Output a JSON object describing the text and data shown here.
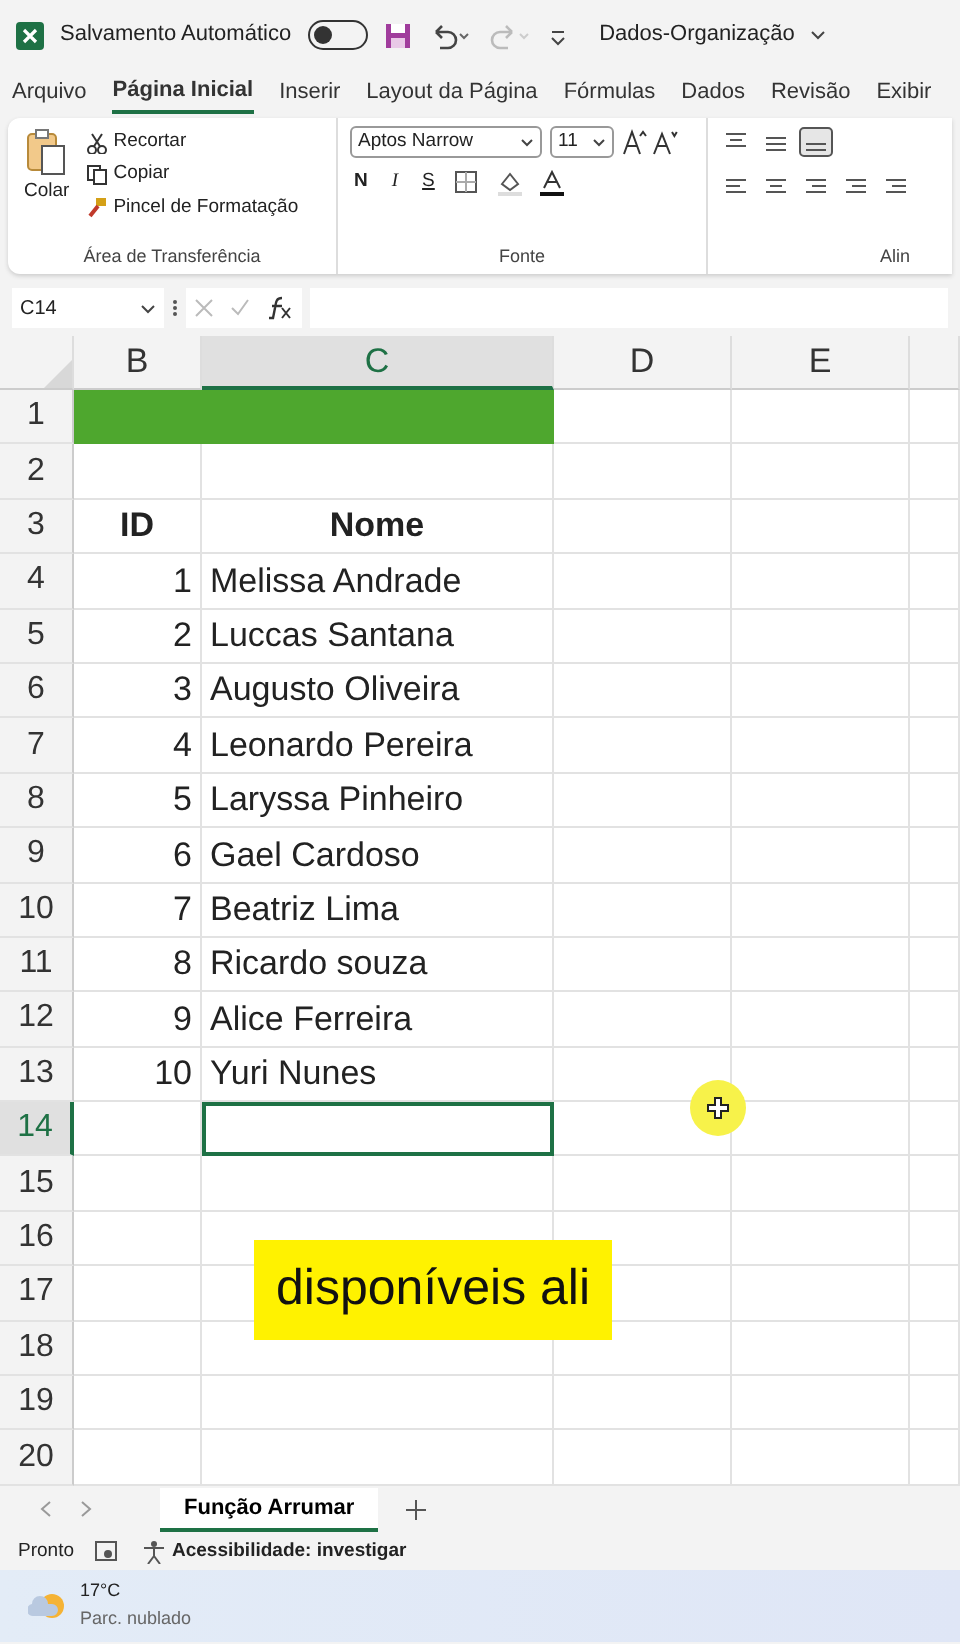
{
  "title_bar": {
    "autosave_label": "Salvamento Automático",
    "autosave_on": false,
    "file_name": "Dados-Organização"
  },
  "tabs": [
    {
      "label": "Arquivo",
      "selected": false
    },
    {
      "label": "Página Inicial",
      "selected": true
    },
    {
      "label": "Inserir",
      "selected": false
    },
    {
      "label": "Layout da Página",
      "selected": false
    },
    {
      "label": "Fórmulas",
      "selected": false
    },
    {
      "label": "Dados",
      "selected": false
    },
    {
      "label": "Revisão",
      "selected": false
    },
    {
      "label": "Exibir",
      "selected": false
    }
  ],
  "ribbon": {
    "clipboard": {
      "paste": "Colar",
      "cut": "Recortar",
      "copy": "Copiar",
      "format_painter": "Pincel de Formatação",
      "group": "Área de Transferência"
    },
    "font": {
      "font_name": "Aptos Narrow",
      "font_size": "11",
      "bold": "N",
      "italic": "I",
      "underline": "S",
      "group": "Fonte"
    },
    "alignment": {
      "group": "Alin"
    }
  },
  "name_box": "C14",
  "columns": [
    {
      "label": "B",
      "selected": false
    },
    {
      "label": "C",
      "selected": true
    },
    {
      "label": "D",
      "selected": false
    },
    {
      "label": "E",
      "selected": false
    }
  ],
  "rows": [
    {
      "number": "1",
      "highlight": true,
      "selected": false
    },
    {
      "number": "2",
      "highlight": false,
      "selected": false
    },
    {
      "number": "3",
      "b": "ID",
      "c": "Nome",
      "header": true,
      "highlight": false,
      "selected": false
    },
    {
      "number": "4",
      "b": "1",
      "c": "Melissa Andrade",
      "highlight": false,
      "selected": false
    },
    {
      "number": "5",
      "b": "2",
      "c": "Luccas Santana",
      "highlight": false,
      "selected": false
    },
    {
      "number": "6",
      "b": "3",
      "c": "Augusto Oliveira",
      "highlight": false,
      "selected": false
    },
    {
      "number": "7",
      "b": "4",
      "c": "Leonardo Pereira",
      "highlight": false,
      "selected": false
    },
    {
      "number": "8",
      "b": "5",
      "c": "Laryssa Pinheiro",
      "highlight": false,
      "selected": false
    },
    {
      "number": "9",
      "b": "6",
      "c": "Gael Cardoso",
      "highlight": false,
      "selected": false
    },
    {
      "number": "10",
      "b": "7",
      "c": "Beatriz Lima",
      "highlight": false,
      "selected": false
    },
    {
      "number": "11",
      "b": "8",
      "c": "Ricardo souza",
      "highlight": false,
      "selected": false
    },
    {
      "number": "12",
      "b": "9",
      "c": "Alice Ferreira",
      "highlight": false,
      "selected": false
    },
    {
      "number": "13",
      "b": "10",
      "c": "Yuri Nunes",
      "highlight": false,
      "selected": false
    },
    {
      "number": "14",
      "highlight": false,
      "selected": true
    },
    {
      "number": "15",
      "highlight": false,
      "selected": false
    },
    {
      "number": "16",
      "highlight": false,
      "selected": false
    },
    {
      "number": "17",
      "highlight": false,
      "selected": false
    },
    {
      "number": "18",
      "highlight": false,
      "selected": false
    },
    {
      "number": "19",
      "highlight": false,
      "selected": false
    },
    {
      "number": "20",
      "highlight": false,
      "selected": false
    }
  ],
  "caption": "disponíveis ali",
  "sheet_tabs": [
    {
      "label": "Função Arrumar",
      "selected": true
    }
  ],
  "status_bar": {
    "ready": "Pronto",
    "accessibility": "Acessibilidade: investigar"
  },
  "taskbar": {
    "temperature": "17°C",
    "condition": "Parc. nublado"
  }
}
